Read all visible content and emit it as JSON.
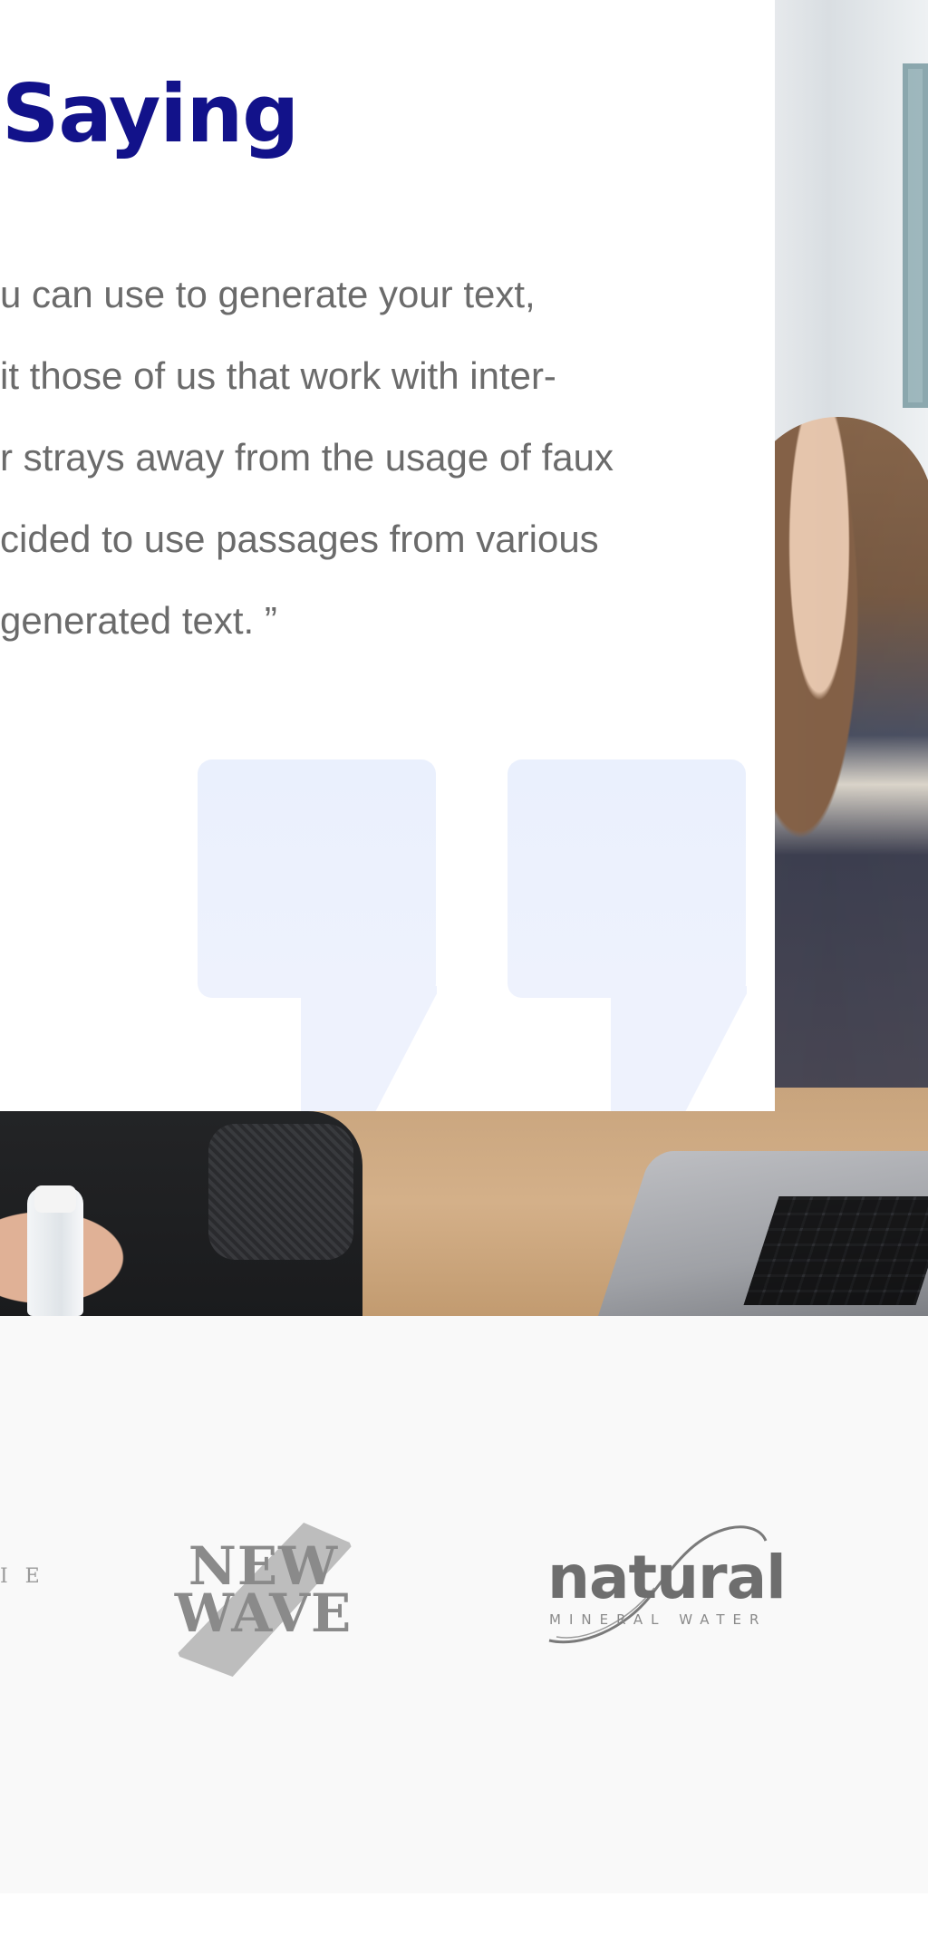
{
  "testimonial": {
    "title": "Saying",
    "quote_lines": [
      "u can use to generate your text,",
      "it those of us that work with inter-",
      "r strays away from the usage of faux",
      "cided to use passages from various",
      "generated text. ”"
    ]
  },
  "logos": {
    "partial_text": "I E",
    "new_wave": {
      "line1": "NEW",
      "line2": "WAVE"
    },
    "natural": {
      "word": "natural",
      "tagline": "MINERAL WATER"
    }
  },
  "colors": {
    "title": "#12128a",
    "body_text": "#6b6b6b",
    "quote_mark": "#eef2fd",
    "logos_background": "#f9f9f9"
  },
  "icons": [
    "quote-mark-icon"
  ]
}
